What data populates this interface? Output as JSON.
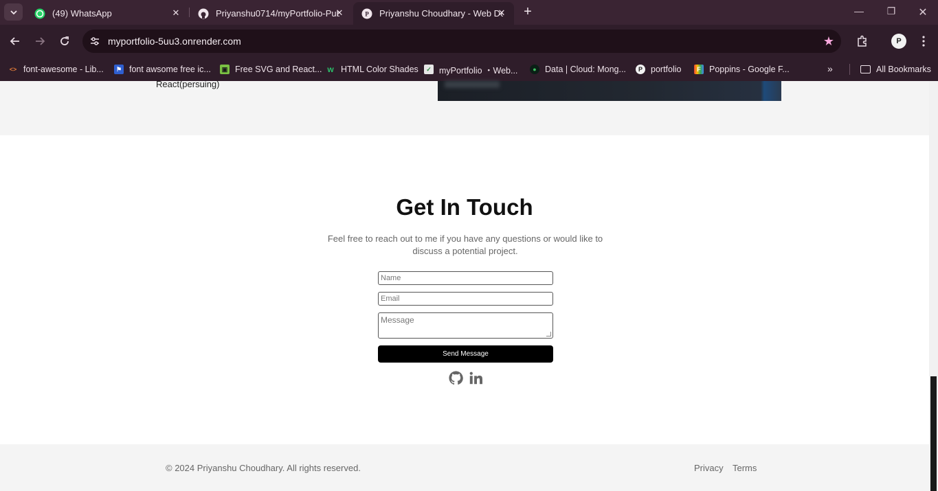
{
  "browser": {
    "tabs": [
      {
        "title": "(49) WhatsApp",
        "icon": "whatsapp-icon"
      },
      {
        "title": "Priyanshu0714/myPortfolio-Pub",
        "icon": "github-icon"
      },
      {
        "title": "Priyanshu Choudhary - Web De",
        "icon": "portfolio-logo-icon"
      }
    ],
    "url": "myportfolio-5uu3.onrender.com",
    "bookmarks": [
      {
        "label": "font-awesome - Lib..."
      },
      {
        "label": "font awsome free ic..."
      },
      {
        "label": "Free SVG and React..."
      },
      {
        "label": "HTML Color Shades"
      },
      {
        "label": "myPortfolio ・Web..."
      },
      {
        "label": "Data | Cloud: Mong..."
      },
      {
        "label": "portfolio"
      },
      {
        "label": "Poppins - Google F..."
      }
    ],
    "all_bookmarks": "All Bookmarks",
    "accent": "#3a2433"
  },
  "about": {
    "skill_text": "React(persuing)"
  },
  "contact": {
    "title": "Get In Touch",
    "lead": "Feel free to reach out to me if you have any questions or would like to discuss a potential project.",
    "name_placeholder": "Name",
    "email_placeholder": "Email",
    "message_placeholder": "Message",
    "send_label": "Send Message"
  },
  "footer": {
    "copyright": "© 2024 Priyanshu Choudhary. All rights reserved.",
    "links": [
      "Privacy",
      "Terms"
    ]
  }
}
